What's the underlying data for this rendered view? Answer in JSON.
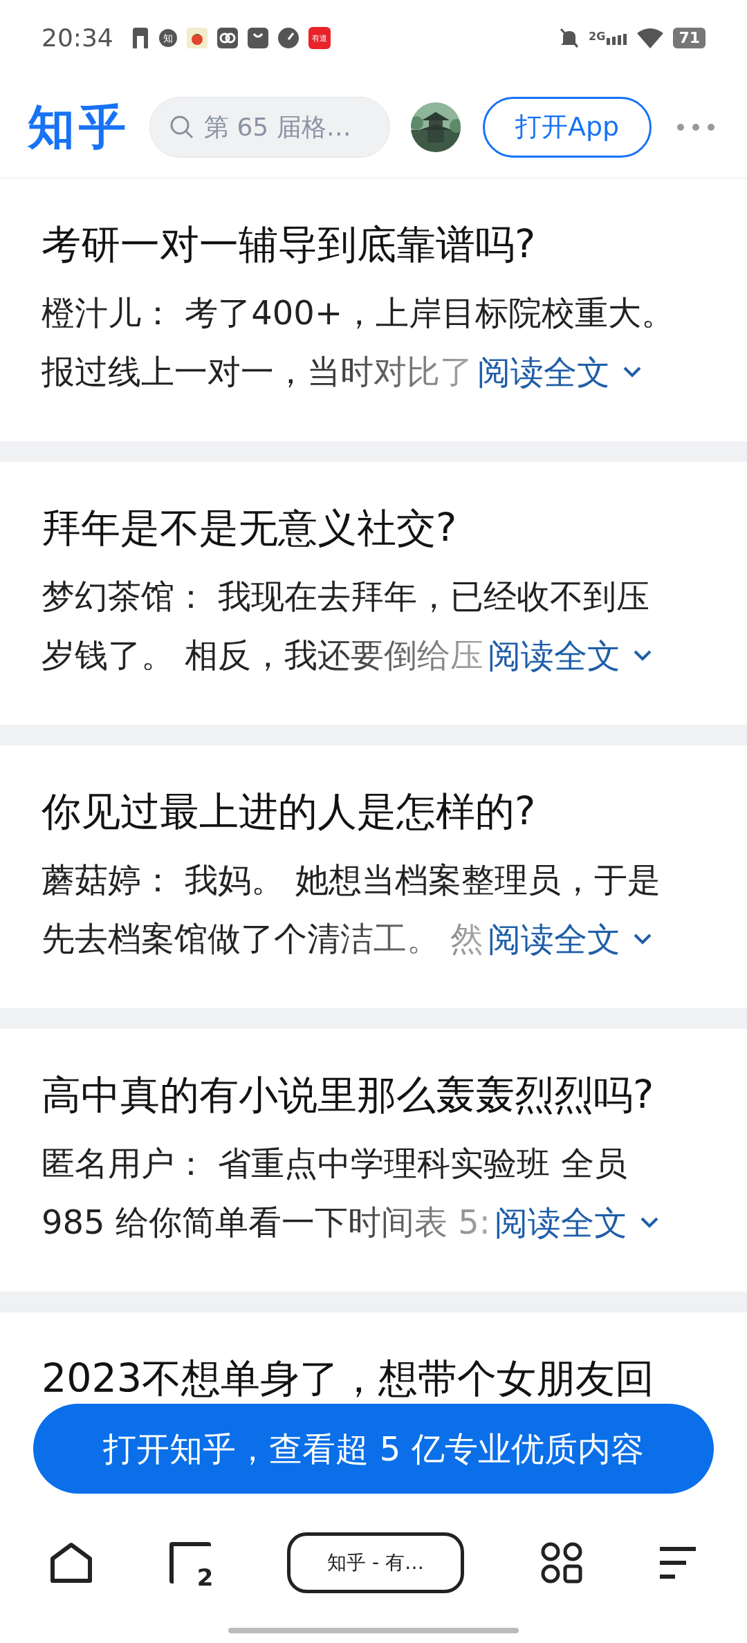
{
  "status_bar": {
    "time": "20:34",
    "zhihu_badge": "知",
    "youdao_badge": "有道",
    "network": "2G",
    "battery": "71"
  },
  "header": {
    "logo": "知乎",
    "search": {
      "placeholder": "第 65 届格…"
    },
    "open_app": "打开App"
  },
  "cards": [
    {
      "title": "考研一对一辅导到底靠谱吗?",
      "excerpt_lines": [
        "橙汁儿： 考了400+，上岸目标院校重大。",
        "报过线上一对一，当时对比了"
      ],
      "read_more": "阅读全文"
    },
    {
      "title": "拜年是不是无意义社交?",
      "excerpt_lines": [
        "梦幻茶馆： 我现在去拜年，已经收不到压",
        "岁钱了。 相反，我还要倒给压"
      ],
      "read_more": "阅读全文"
    },
    {
      "title": "你见过最上进的人是怎样的?",
      "excerpt_lines": [
        "蘑菇婷： 我妈。 她想当档案整理员，于是",
        "先去档案馆做了个清洁工。 然"
      ],
      "read_more": "阅读全文"
    },
    {
      "title": "高中真的有小说里那么轰轰烈烈吗?",
      "excerpt_lines": [
        "匿名用户： 省重点中学理科实验班 全员",
        "985 给你简单看一下时间表 5:"
      ],
      "read_more": "阅读全文"
    },
    {
      "title": "2023不想单身了，想带个女朋友回"
    }
  ],
  "banner": "打开知乎，查看超 5 亿专业优质内容",
  "browser_bar": {
    "tab_count": "2",
    "page_title": "知乎 - 有…"
  }
}
